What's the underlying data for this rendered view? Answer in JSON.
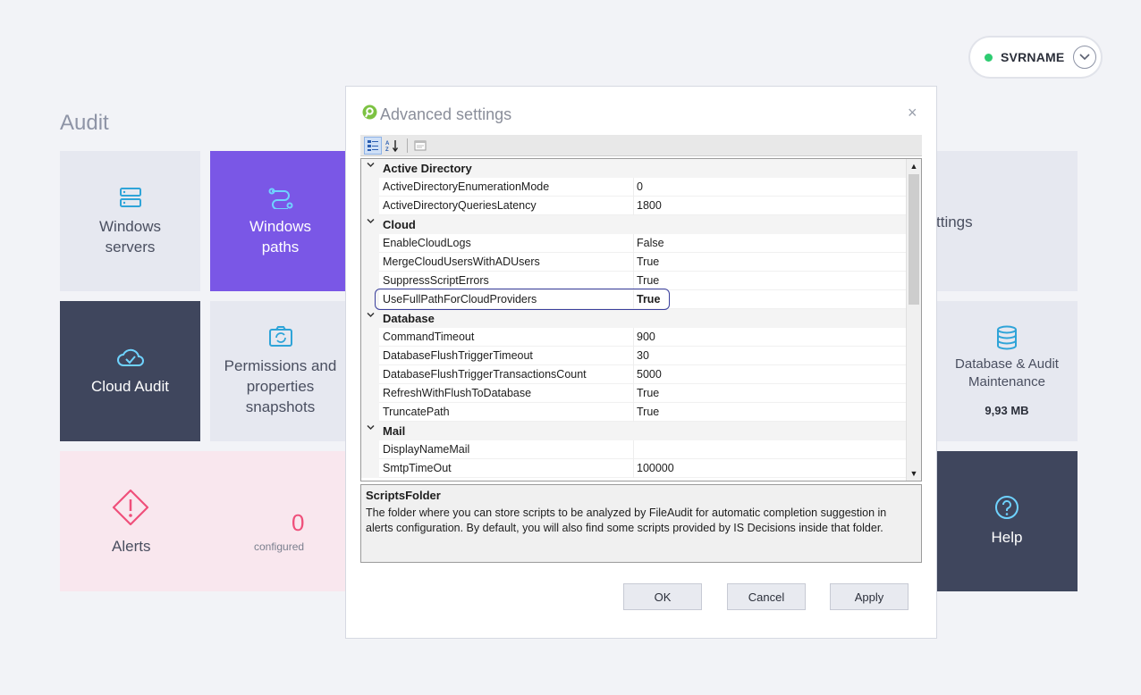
{
  "server": {
    "name": "SVRNAME"
  },
  "section_title": "Audit",
  "tiles": {
    "windows_servers": "Windows\nservers",
    "windows_paths": "Windows\npaths",
    "cloud_audit": "Cloud Audit",
    "permissions": "Permissions and\nproperties\nsnapshots",
    "alerts": "Alerts",
    "alerts_count": "0",
    "alerts_sub": "configured",
    "settings_partial": "ttings",
    "database": "Database & Audit\nMaintenance",
    "database_size": "9,93 MB",
    "help": "Help"
  },
  "colors": {
    "accent_purple": "#7a57e6",
    "dark_tile": "#3f465d",
    "status_green": "#2ecc71",
    "highlight_border": "#3a3f9c"
  },
  "dialog": {
    "title": "Advanced settings",
    "close": "×",
    "grid": {
      "rows": [
        {
          "type": "category",
          "name": "Active Directory"
        },
        {
          "type": "prop",
          "name": "ActiveDirectoryEnumerationMode",
          "value": "0"
        },
        {
          "type": "prop",
          "name": "ActiveDirectoryQueriesLatency",
          "value": "1800"
        },
        {
          "type": "category",
          "name": "Cloud"
        },
        {
          "type": "prop",
          "name": "EnableCloudLogs",
          "value": "False"
        },
        {
          "type": "prop",
          "name": "MergeCloudUsersWithADUsers",
          "value": "True"
        },
        {
          "type": "prop",
          "name": "SuppressScriptErrors",
          "value": "True"
        },
        {
          "type": "prop",
          "name": "UseFullPathForCloudProviders",
          "value": "True",
          "bold": true
        },
        {
          "type": "category",
          "name": "Database"
        },
        {
          "type": "prop",
          "name": "CommandTimeout",
          "value": "900"
        },
        {
          "type": "prop",
          "name": "DatabaseFlushTriggerTimeout",
          "value": "30"
        },
        {
          "type": "prop",
          "name": "DatabaseFlushTriggerTransactionsCount",
          "value": "5000"
        },
        {
          "type": "prop",
          "name": "RefreshWithFlushToDatabase",
          "value": "True"
        },
        {
          "type": "prop",
          "name": "TruncatePath",
          "value": "True"
        },
        {
          "type": "category",
          "name": "Mail"
        },
        {
          "type": "prop",
          "name": "DisplayNameMail",
          "value": ""
        },
        {
          "type": "prop",
          "name": "SmtpTimeOut",
          "value": "100000"
        }
      ]
    },
    "description": {
      "title": "ScriptsFolder",
      "text": "The folder where you can store scripts to be analyzed by FileAudit for automatic completion suggestion in alerts configuration. By default, you will also find some scripts provided by IS Decisions inside that folder."
    },
    "buttons": {
      "ok": "OK",
      "cancel": "Cancel",
      "apply": "Apply"
    }
  }
}
